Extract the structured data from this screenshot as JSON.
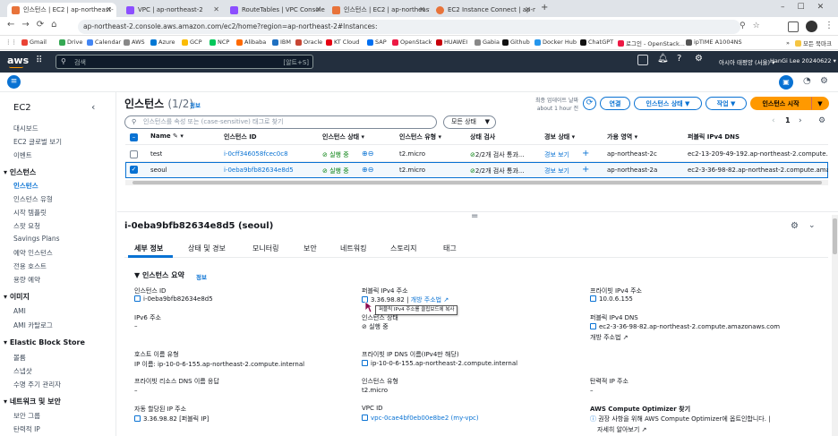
{
  "browser": {
    "tabs": [
      {
        "title": "인스턴스 | EC2 | ap-northeast-",
        "color": "#e8733a"
      },
      {
        "title": "VPC | ap-northeast-2",
        "color": "#8c4fff"
      },
      {
        "title": "RouteTables | VPC Console",
        "color": "#8c4fff"
      },
      {
        "title": "인스턴스 | EC2 | ap-northeast-",
        "color": "#e8733a"
      },
      {
        "title": "EC2 Instance Connect | ap-nor",
        "color": "#e8733a"
      }
    ],
    "url": "ap-northeast-2.console.aws.amazon.com/ec2/home?region=ap-northeast-2#Instances:",
    "bookmarks": [
      "Gmail",
      "Drive",
      "Calendar",
      "AWS",
      "Azure",
      "GCP",
      "NCP",
      "Alibaba",
      "IBM",
      "Oracle",
      "KT Cloud",
      "SAP",
      "OpenStack",
      "HUAWEI",
      "Gabia",
      "Github",
      "Docker Hub",
      "ChatGPT",
      "로그인 - OpenStack...",
      "ipTIME A1004NS"
    ],
    "other_bookmarks": "모든 북마크"
  },
  "aws": {
    "logo": "aws",
    "search_placeholder": "검색",
    "search_shortcut": "[알트+S]",
    "region": "아시아 태평양 (서울)",
    "account": "HanGi Lee 20240622"
  },
  "sidebar": {
    "title": "EC2",
    "top_items": [
      "대시보드",
      "EC2 글로벌 보기",
      "이벤트"
    ],
    "sections": [
      {
        "heading": "인스턴스",
        "items": [
          "인스턴스",
          "인스턴스 유형",
          "시작 템플릿",
          "스팟 요청",
          "Savings Plans",
          "예약 인스턴스",
          "전용 호스트",
          "용량 예약"
        ]
      },
      {
        "heading": "이미지",
        "items": [
          "AMI",
          "AMI 카탈로그"
        ]
      },
      {
        "heading": "Elastic Block Store",
        "items": [
          "볼륨",
          "스냅샷",
          "수명 주기 관리자"
        ]
      },
      {
        "heading": "네트워크 및 보안",
        "items": [
          "보안 그룹",
          "탄력적 IP"
        ]
      }
    ]
  },
  "instances": {
    "title": "인스턴스",
    "count": "(1/2)",
    "info": "정보",
    "last_updated_line1": "최종 업데이트 날짜",
    "last_updated_line2": "about 1 hour 전",
    "connect_btn": "연결",
    "state_btn": "인스턴스 상태",
    "actions_btn": "작업",
    "launch_btn": "인스턴스 시작",
    "filter_placeholder": "인스턴스를 속성 또는 (case-sensitive) 태그로 찾기",
    "state_filter": "모든 상태",
    "page": "1",
    "columns": [
      "Name",
      "인스턴스 ID",
      "인스턴스 상태",
      "인스턴스 유형",
      "상태 검사",
      "경보 상태",
      "가용 영역",
      "퍼블릭 IPv4 DNS"
    ],
    "rows": [
      {
        "name": "test",
        "id": "i-0cff346058fcec0c8",
        "state": "실행 중",
        "type": "t2.micro",
        "check": "2/2개 검사 통과...",
        "alarm": "경보 보기",
        "az": "ap-northeast-2c",
        "dns": "ec2-13-209-49-192.ap-northeast-2.compute.",
        "selected": false
      },
      {
        "name": "seoul",
        "id": "i-0eba9bfb82634e8d5",
        "state": "실행 중",
        "type": "t2.micro",
        "check": "2/2개 검사 통과...",
        "alarm": "경보 보기",
        "az": "ap-northeast-2a",
        "dns": "ec2-3-36-98-82.ap-northeast-2.compute.ama",
        "selected": true
      }
    ]
  },
  "details": {
    "title": "i-0eba9bfb82634e8d5 (seoul)",
    "tabs": [
      "세부 정보",
      "상태 및 경보",
      "모니터링",
      "보안",
      "네트워킹",
      "스토리지",
      "태그"
    ],
    "summary_heading": "인스턴스 요약",
    "summary_info": "정보",
    "fields": {
      "instance_id_label": "인스턴스 ID",
      "instance_id": "i-0eba9bfb82634e8d5",
      "public_ip_label": "퍼블릭 IPv4 주소",
      "public_ip": "3.36.98.82",
      "open_addr": "개방 주소법",
      "tooltip": "퍼블릭 IPv4 주소를 클립보드에 복사",
      "private_ip_label": "프라이빗 IPv4 주소",
      "private_ip": "10.0.6.155",
      "ipv6_label": "IPv6 주소",
      "ipv6": "–",
      "state_label": "인스턴스 상태",
      "state": "실행 중",
      "public_dns_label": "퍼블릭 IPv4 DNS",
      "public_dns": "ec2-3-36-98-82.ap-northeast-2.compute.amazonaws.com",
      "public_dns_open": "개방 주소법",
      "hostname_type_label": "호스트 이름 유형",
      "hostname_type": "IP 이름: ip-10-0-6-155.ap-northeast-2.compute.internal",
      "private_dns_label": "프라이빗 IP DNS 이름(IPv4만 해당)",
      "private_dns": "ip-10-0-6-155.ap-northeast-2.compute.internal",
      "resource_dns_label": "프라이빗 리소스 DNS 이름 응답",
      "resource_dns": "–",
      "instance_type_label": "인스턴스 유형",
      "instance_type": "t2.micro",
      "elastic_ip_label": "탄력적 IP 주소",
      "elastic_ip": "–",
      "auto_ip_label": "자동 할당된 IP 주소",
      "auto_ip": "3.36.98.82 [퍼블릭 IP]",
      "vpc_label": "VPC ID",
      "vpc": "vpc-0cae4bf0eb00e8be2 (my-vpc)",
      "optimizer_label": "AWS Compute Optimizer 찾기",
      "optimizer_text": "권장 사항을 위해 AWS Compute Optimizer에 옵트인합니다.",
      "optimizer_link": "자세히 알아보기"
    }
  },
  "colors": {
    "aws_nav": "#232f3e",
    "link": "#0972d3",
    "green": "#037f0c",
    "orange": "#ff9900"
  }
}
